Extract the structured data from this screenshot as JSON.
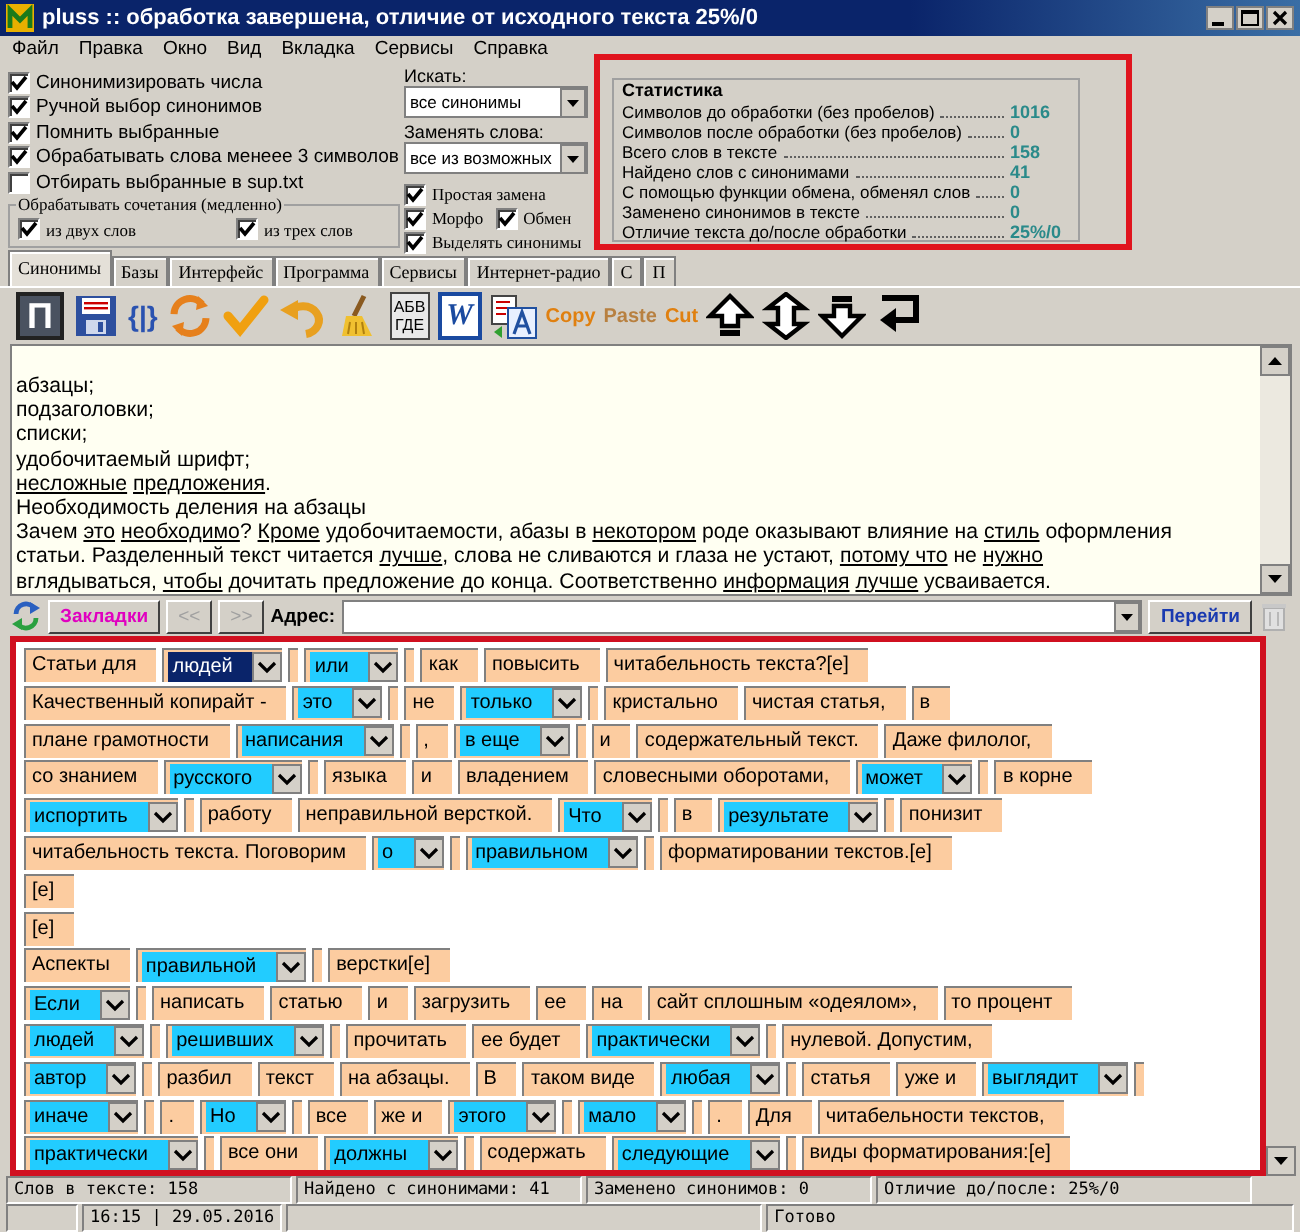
{
  "window": {
    "title": "pluss :: обработка завершена, отличие от исходного текста 25%/0"
  },
  "menu": [
    "Файл",
    "Правка",
    "Окно",
    "Вид",
    "Вкладка",
    "Сервисы",
    "Справка"
  ],
  "options": [
    {
      "label": "Синонимизировать числа",
      "checked": true
    },
    {
      "label": "Ручной выбор синонимов",
      "checked": true
    },
    {
      "label": "Помнить выбранные",
      "checked": true
    },
    {
      "label": "Обрабатывать слова менеее 3 символов",
      "checked": true
    },
    {
      "label": "Отбирать выбранные в sup.txt",
      "checked": false
    }
  ],
  "combos_group": {
    "title": "Обрабатывать сочетания (медленно)",
    "options": [
      {
        "label": "из двух слов",
        "checked": true
      },
      {
        "label": "из трех слов",
        "checked": true
      }
    ]
  },
  "search": {
    "label": "Искать:",
    "value": "все синонимы"
  },
  "replace": {
    "label": "Заменять слова:",
    "value": "все из возможных"
  },
  "mode_options": [
    {
      "label": "Простая замена",
      "checked": true
    },
    {
      "label": "Морфо",
      "checked": true
    },
    {
      "label": "Обмен",
      "checked": true
    },
    {
      "label": "Выделять синонимы",
      "checked": true
    }
  ],
  "statistics": {
    "title": "Статистика",
    "highlighted": true,
    "rows": [
      {
        "label": "Символов до обработки (без пробелов)",
        "value": "1016"
      },
      {
        "label": "Символов после обработки (без пробелов)",
        "value": "0"
      },
      {
        "label": "Всего слов в тексте",
        "value": "158"
      },
      {
        "label": "Найдено слов с синонимами",
        "value": "41"
      },
      {
        "label": "С помощью функции обмена, обменял слов",
        "value": "0"
      },
      {
        "label": "Заменено синонимов в тексте",
        "value": "0"
      },
      {
        "label": "Отличие текста до/после обработки",
        "value": "25%/0"
      }
    ]
  },
  "tabs": [
    {
      "label": "Синонимы",
      "selected": true
    },
    {
      "label": "Базы",
      "selected": false
    },
    {
      "label": "Интерфейс",
      "selected": false
    },
    {
      "label": "Программа",
      "selected": false
    },
    {
      "label": "Сервисы",
      "selected": false
    },
    {
      "label": "Интернет-радио",
      "selected": false
    },
    {
      "label": "С",
      "selected": false
    },
    {
      "label": "П",
      "selected": false
    }
  ],
  "toolbar": [
    {
      "kind": "tile",
      "label": "П"
    },
    {
      "kind": "save"
    },
    {
      "kind": "code",
      "label": "{|}"
    },
    {
      "kind": "sync"
    },
    {
      "kind": "check"
    },
    {
      "kind": "undo"
    },
    {
      "kind": "broom"
    },
    {
      "kind": "abc",
      "lines": [
        "АБВ",
        "ГДЕ"
      ]
    },
    {
      "kind": "word",
      "label": "W"
    },
    {
      "kind": "translate"
    },
    {
      "kind": "clip",
      "label": "Copy",
      "disabled": false
    },
    {
      "kind": "clip",
      "label": "Paste",
      "disabled": true
    },
    {
      "kind": "clip",
      "label": "Cut",
      "disabled": false
    },
    {
      "kind": "up"
    },
    {
      "kind": "updown"
    },
    {
      "kind": "down"
    },
    {
      "kind": "enter"
    }
  ],
  "text_lines": [
    [
      {
        "text": "абзацы;",
        "underlined": false
      }
    ],
    [
      {
        "text": "подзаголовки;",
        "underlined": false
      }
    ],
    [
      {
        "text": "списки;",
        "underlined": false
      }
    ],
    [
      {
        "text": "удобочитаемый шрифт;",
        "underlined": false
      }
    ],
    [
      {
        "text": "несложные",
        "underlined": true
      },
      {
        "text": "предложения",
        "underlined": true
      },
      {
        "text": ".",
        "underlined": false
      }
    ],
    [
      {
        "text": "Необходимость деления на абзацы",
        "underlined": false
      }
    ],
    [
      {
        "text": "Зачем ",
        "underlined": false
      },
      {
        "text": "это",
        "underlined": true
      },
      {
        "text": "необходимо",
        "underlined": true
      },
      {
        "text": "? ",
        "underlined": false
      },
      {
        "text": "Кроме",
        "underlined": true
      },
      {
        "text": " удобочитаемости, абазы в ",
        "underlined": false
      },
      {
        "text": "некотором",
        "underlined": true
      },
      {
        "text": " роде оказывают влияние на ",
        "underlined": false
      },
      {
        "text": "стиль",
        "underlined": true
      },
      {
        "text": " оформления",
        "underlined": false
      }
    ],
    [
      {
        "text": "статьи. Разделенный текст читается ",
        "underlined": false
      },
      {
        "text": "лучше",
        "underlined": true
      },
      {
        "text": ", слова не сливаются и глаза не устают, ",
        "underlined": false
      },
      {
        "text": "потому что",
        "underlined": true
      },
      {
        "text": " не ",
        "underlined": false
      },
      {
        "text": "нужно",
        "underlined": true
      }
    ],
    [
      {
        "text": "вглядываться, ",
        "underlined": false
      },
      {
        "text": "чтобы",
        "underlined": true
      },
      {
        "text": " дочитать предложение до конца. Соответственно ",
        "underlined": false
      },
      {
        "text": "информация",
        "underlined": true
      },
      {
        "text": "лучше",
        "underlined": true
      },
      {
        "text": " усваивается.",
        "underlined": false
      }
    ]
  ],
  "address_bar": {
    "bookmarks": "Закладки",
    "back": "<<",
    "forward": ">>",
    "label": "Адрес:",
    "go": "Перейти"
  },
  "grid": {
    "highlighted": true,
    "rows": [
      {
        "items": [
          {
            "kind": "word",
            "text": "Статьи для"
          },
          {
            "kind": "choice",
            "text": "людей",
            "selected": true
          },
          {
            "kind": "choice",
            "text": "или",
            "selected": false
          },
          {
            "kind": "word",
            "text": "как"
          },
          {
            "kind": "word",
            "text": "повысить"
          },
          {
            "kind": "word",
            "text": "читабельность текста?[e]"
          }
        ]
      },
      {
        "items": [
          {
            "kind": "word",
            "text": "Качественный копирайт -"
          },
          {
            "kind": "choice",
            "text": "это",
            "selected": false
          },
          {
            "kind": "word",
            "text": "не"
          },
          {
            "kind": "choice",
            "text": "только",
            "selected": false
          },
          {
            "kind": "word",
            "text": "кристально"
          },
          {
            "kind": "word",
            "text": "чистая статья,"
          },
          {
            "kind": "word",
            "text": "в"
          }
        ]
      },
      {
        "items": [
          {
            "kind": "word",
            "text": "плане грамотности"
          },
          {
            "kind": "choice",
            "text": "написания",
            "selected": false
          },
          {
            "kind": "word",
            "text": ","
          },
          {
            "kind": "choice",
            "text": "в еще",
            "selected": false
          },
          {
            "kind": "word",
            "text": "и"
          },
          {
            "kind": "word",
            "text": "содержательный текст."
          },
          {
            "kind": "word",
            "text": "Даже филолог,"
          }
        ]
      },
      {
        "items": [
          {
            "kind": "word",
            "text": "со знанием"
          },
          {
            "kind": "choice",
            "text": "русского",
            "selected": false
          },
          {
            "kind": "word",
            "text": "языка"
          },
          {
            "kind": "word",
            "text": "и"
          },
          {
            "kind": "word",
            "text": "владением"
          },
          {
            "kind": "word",
            "text": "словесными оборотами,"
          },
          {
            "kind": "choice",
            "text": "может",
            "selected": false
          },
          {
            "kind": "word",
            "text": "в корне"
          }
        ]
      },
      {
        "items": [
          {
            "kind": "choice",
            "text": "испортить",
            "selected": false
          },
          {
            "kind": "word",
            "text": "работу"
          },
          {
            "kind": "word",
            "text": "неправильной версткой."
          },
          {
            "kind": "choice",
            "text": "Что",
            "selected": false
          },
          {
            "kind": "word",
            "text": "в"
          },
          {
            "kind": "choice",
            "text": "результате",
            "selected": false
          },
          {
            "kind": "word",
            "text": "понизит"
          }
        ]
      },
      {
        "items": [
          {
            "kind": "word",
            "text": "читабельность текста. Поговорим"
          },
          {
            "kind": "choice",
            "text": "о",
            "selected": false
          },
          {
            "kind": "choice",
            "text": "правильном",
            "selected": false
          },
          {
            "kind": "word",
            "text": "форматировании текстов.[e]"
          }
        ]
      },
      {
        "items": [
          {
            "kind": "word",
            "text": "[e]"
          }
        ]
      },
      {
        "items": [
          {
            "kind": "word",
            "text": "[e]"
          }
        ]
      },
      {
        "items": [
          {
            "kind": "word",
            "text": "Аспекты"
          },
          {
            "kind": "choice",
            "text": "правильной",
            "selected": false
          },
          {
            "kind": "word",
            "text": "верстки[e]"
          }
        ]
      },
      {
        "items": [
          {
            "kind": "choice",
            "text": "Если",
            "selected": false
          },
          {
            "kind": "word",
            "text": "написать"
          },
          {
            "kind": "word",
            "text": "статью"
          },
          {
            "kind": "word",
            "text": "и"
          },
          {
            "kind": "word",
            "text": "загрузить"
          },
          {
            "kind": "word",
            "text": "ее"
          },
          {
            "kind": "word",
            "text": "на"
          },
          {
            "kind": "word",
            "text": "сайт сплошным «одеялом»,"
          },
          {
            "kind": "word",
            "text": "то процент"
          }
        ]
      },
      {
        "items": [
          {
            "kind": "choice",
            "text": "людей",
            "selected": false
          },
          {
            "kind": "choice",
            "text": "решивших",
            "selected": false
          },
          {
            "kind": "word",
            "text": "прочитать"
          },
          {
            "kind": "word",
            "text": "ее будет"
          },
          {
            "kind": "choice",
            "text": "практически",
            "selected": false
          },
          {
            "kind": "word",
            "text": "нулевой. Допустим,"
          }
        ]
      },
      {
        "items": [
          {
            "kind": "choice",
            "text": "автор",
            "selected": false
          },
          {
            "kind": "word",
            "text": "разбил"
          },
          {
            "kind": "word",
            "text": "текст"
          },
          {
            "kind": "word",
            "text": "на абзацы."
          },
          {
            "kind": "word",
            "text": "В"
          },
          {
            "kind": "word",
            "text": "таком виде"
          },
          {
            "kind": "choice",
            "text": "любая",
            "selected": false
          },
          {
            "kind": "word",
            "text": "статья"
          },
          {
            "kind": "word",
            "text": "уже и"
          },
          {
            "kind": "choice",
            "text": "выглядит",
            "selected": false
          }
        ]
      },
      {
        "items": [
          {
            "kind": "choice",
            "text": "иначе",
            "selected": false
          },
          {
            "kind": "word",
            "text": "."
          },
          {
            "kind": "choice",
            "text": "Но",
            "selected": false
          },
          {
            "kind": "word",
            "text": "все"
          },
          {
            "kind": "word",
            "text": "же и"
          },
          {
            "kind": "choice",
            "text": "этого",
            "selected": false
          },
          {
            "kind": "choice",
            "text": "мало",
            "selected": false
          },
          {
            "kind": "word",
            "text": "."
          },
          {
            "kind": "word",
            "text": "Для"
          },
          {
            "kind": "word",
            "text": "читабельности текстов,"
          }
        ]
      },
      {
        "items": [
          {
            "kind": "choice",
            "text": "практически",
            "selected": false
          },
          {
            "kind": "word",
            "text": "все они"
          },
          {
            "kind": "choice",
            "text": "должны",
            "selected": false
          },
          {
            "kind": "word",
            "text": "содержать"
          },
          {
            "kind": "choice",
            "text": "следующие",
            "selected": false
          },
          {
            "kind": "word",
            "text": "виды форматирования:[e]"
          }
        ]
      }
    ]
  },
  "status_bar": [
    "Слов в тексте: 158",
    "Найдено с синонимами: 41",
    "Заменено синонимов: 0",
    "Отличие до/после: 25%/0"
  ],
  "footer_bar": {
    "clock": "16:15 | 29.05.2016",
    "message": "Готово"
  }
}
